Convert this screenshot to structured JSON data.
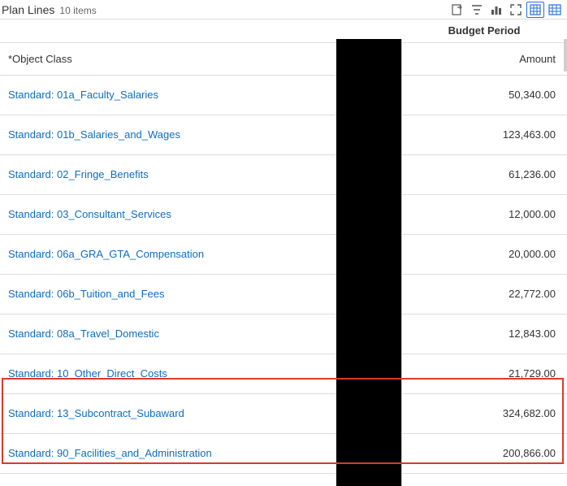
{
  "header": {
    "title": "Plan Lines",
    "item_count": "10 items"
  },
  "columns": {
    "budget_period": "Budget Period",
    "object_class": "*Object Class",
    "amount": "Amount"
  },
  "rows": [
    {
      "label": "Standard: 01a_Faculty_Salaries",
      "amount": "50,340.00"
    },
    {
      "label": "Standard: 01b_Salaries_and_Wages",
      "amount": "123,463.00"
    },
    {
      "label": "Standard: 02_Fringe_Benefits",
      "amount": "61,236.00"
    },
    {
      "label": "Standard: 03_Consultant_Services",
      "amount": "12,000.00"
    },
    {
      "label": "Standard: 06a_GRA_GTA_Compensation",
      "amount": "20,000.00"
    },
    {
      "label": "Standard: 06b_Tuition_and_Fees",
      "amount": "22,772.00"
    },
    {
      "label": "Standard: 08a_Travel_Domestic",
      "amount": "12,843.00"
    },
    {
      "label": "Standard: 10_Other_Direct_Costs",
      "amount": "21,729.00"
    },
    {
      "label": "Standard: 13_Subcontract_Subaward",
      "amount": "324,682.00"
    },
    {
      "label": "Standard: 90_Facilities_and_Administration",
      "amount": "200,866.00"
    }
  ]
}
